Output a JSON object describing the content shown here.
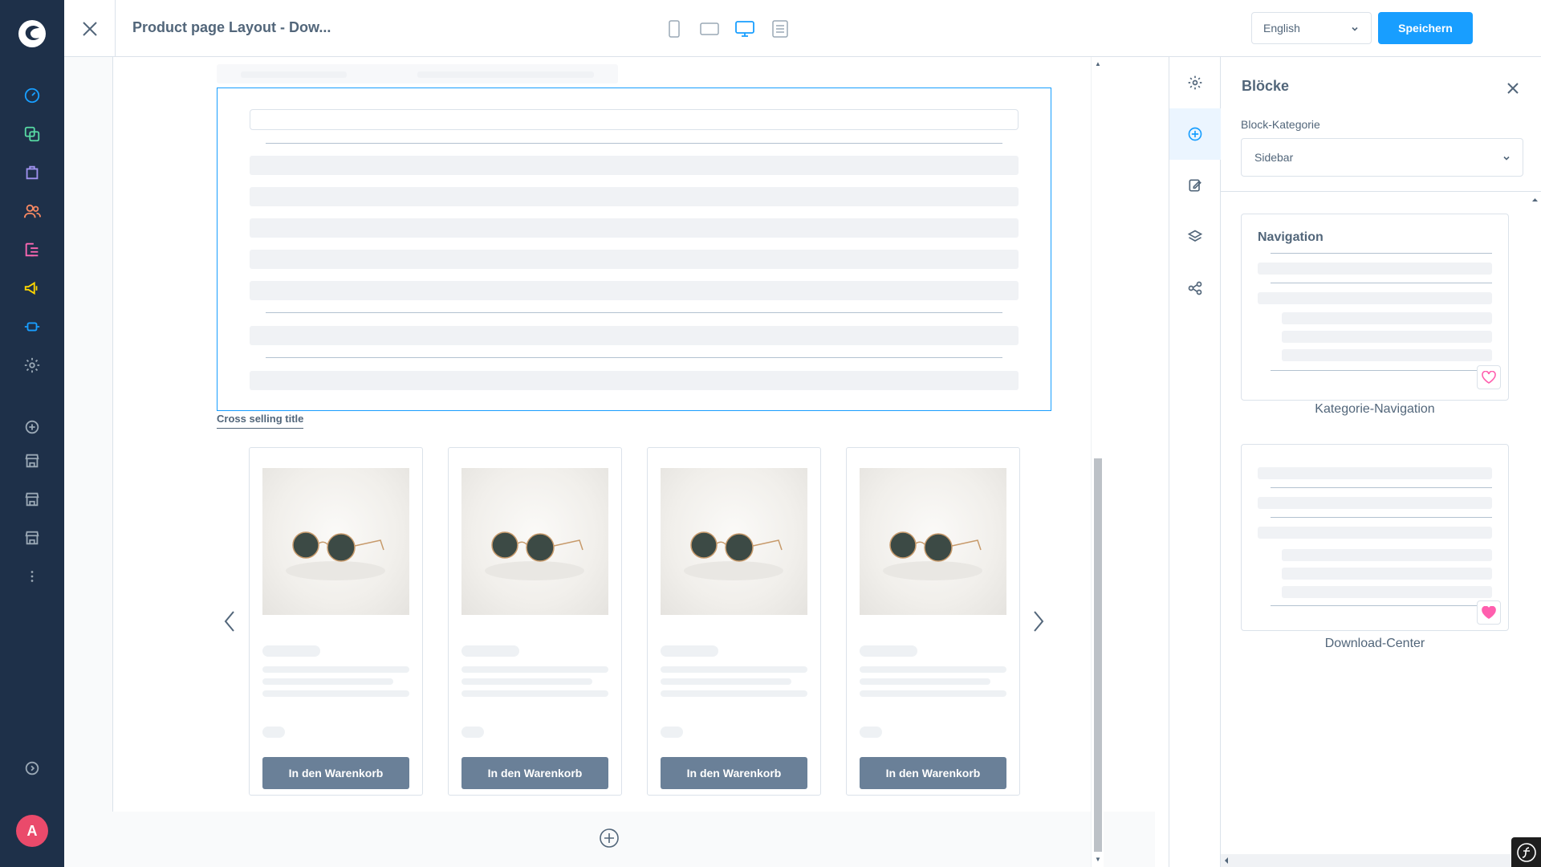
{
  "topbar": {
    "title": "Product page Layout - Dow...",
    "language": "English",
    "save_label": "Speichern"
  },
  "user": {
    "initial": "A"
  },
  "canvas": {
    "cross_selling_title": "Cross selling title",
    "products": [
      {
        "buy_label": "In den Warenkorb"
      },
      {
        "buy_label": "In den Warenkorb"
      },
      {
        "buy_label": "In den Warenkorb"
      },
      {
        "buy_label": "In den Warenkorb"
      }
    ]
  },
  "panel": {
    "title": "Blöcke",
    "category_label": "Block-Kategorie",
    "category_value": "Sidebar",
    "blocks": [
      {
        "preview_title": "Navigation",
        "name": "Kategorie-Navigation",
        "favorite": false
      },
      {
        "preview_title": "",
        "name": "Download-Center",
        "favorite": true
      }
    ]
  },
  "colors": {
    "nav_bg": "#1e3049",
    "accent": "#189eff",
    "buy_button": "#6a8098",
    "favorite": "#ff5fae",
    "avatar": "#ea4a6b"
  },
  "icons": {
    "nav": [
      "dashboard-icon",
      "catalogue-icon",
      "orders-icon",
      "customers-icon",
      "content-icon",
      "marketing-icon",
      "extensions-icon",
      "settings-icon",
      "add-sales-channel-icon",
      "storefront-icon",
      "storefront-icon",
      "storefront-icon",
      "more-icon",
      "collapse-icon"
    ],
    "tabs": [
      "settings-icon",
      "add-block-icon",
      "edit-icon",
      "layers-icon",
      "share-icon"
    ],
    "devices": [
      "mobile-icon",
      "tablet-icon",
      "desktop-icon",
      "form-icon"
    ]
  }
}
